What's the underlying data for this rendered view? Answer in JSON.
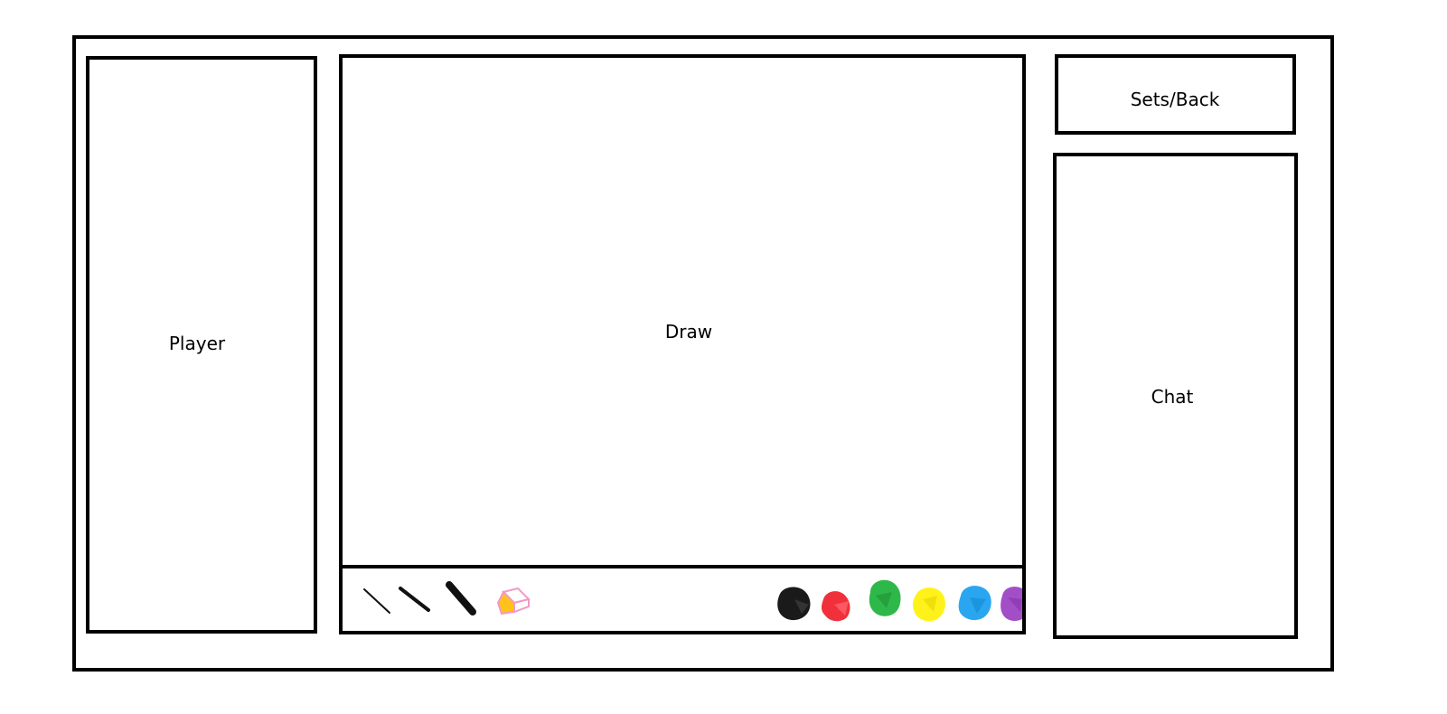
{
  "panels": {
    "player": {
      "label": "Player"
    },
    "draw": {
      "label": "Draw"
    },
    "sets": {
      "label": "Sets/Back"
    },
    "chat": {
      "label": "Chat"
    }
  },
  "toolbar": {
    "brushes": [
      {
        "name": "thin-brush-icon"
      },
      {
        "name": "medium-brush-icon"
      },
      {
        "name": "thick-brush-icon"
      }
    ],
    "eraser": {
      "name": "eraser-icon"
    },
    "colors": [
      {
        "name": "black",
        "hex": "#1a1a1a"
      },
      {
        "name": "red",
        "hex": "#f0303a"
      },
      {
        "name": "green",
        "hex": "#2fb84a"
      },
      {
        "name": "yellow",
        "hex": "#fff21a"
      },
      {
        "name": "blue",
        "hex": "#2aa6f0"
      },
      {
        "name": "purple",
        "hex": "#a24fc7"
      }
    ]
  }
}
